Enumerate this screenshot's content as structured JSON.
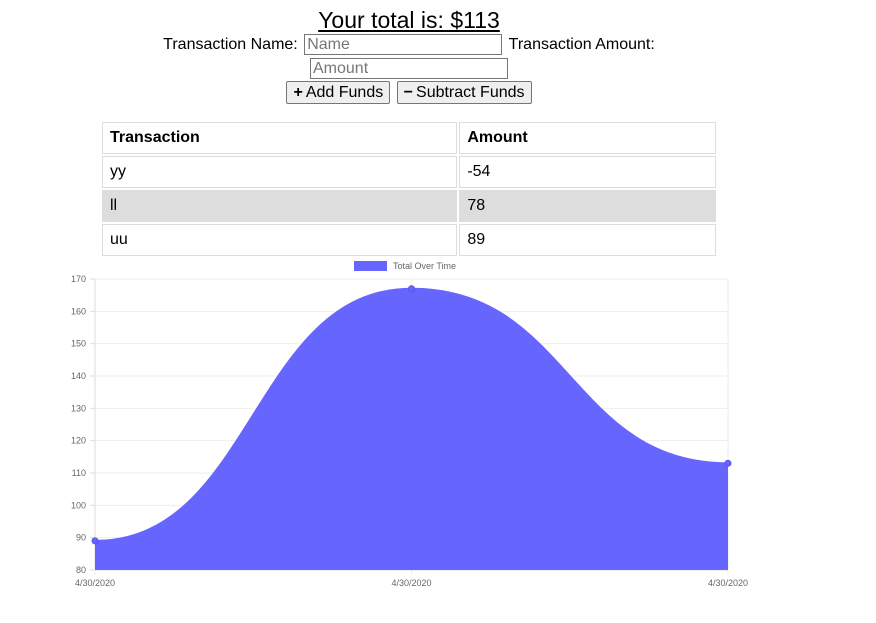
{
  "total": {
    "text": "Your total is: $113"
  },
  "form": {
    "name_label": "Transaction Name:",
    "name_placeholder": "Name",
    "amount_label": "Transaction Amount:",
    "amount_placeholder": "Amount",
    "add_icon": "plus-icon",
    "add_label": "Add Funds",
    "subtract_icon": "minus-icon",
    "subtract_label": "Subtract Funds"
  },
  "table": {
    "headers": [
      "Transaction",
      "Amount"
    ],
    "rows": [
      {
        "name": "yy",
        "amount": "-54"
      },
      {
        "name": "ll",
        "amount": "78"
      },
      {
        "name": "uu",
        "amount": "89"
      }
    ]
  },
  "chart_data": {
    "type": "area",
    "legend": {
      "label": "Total Over Time",
      "placement": "top",
      "color": "#6666ff"
    },
    "x": [
      "4/30/2020",
      "4/30/2020",
      "4/30/2020"
    ],
    "series": [
      {
        "name": "Total Over Time",
        "values": [
          89,
          167,
          113
        ],
        "color": "#6666ff"
      }
    ],
    "ylim": [
      80,
      170
    ],
    "yticks": [
      80,
      90,
      100,
      110,
      120,
      130,
      140,
      150,
      160,
      170
    ],
    "grid": true
  },
  "colors": {
    "area_fill": "#6666ff",
    "stripe": "#dddddd",
    "grid": "#eeeeee"
  }
}
